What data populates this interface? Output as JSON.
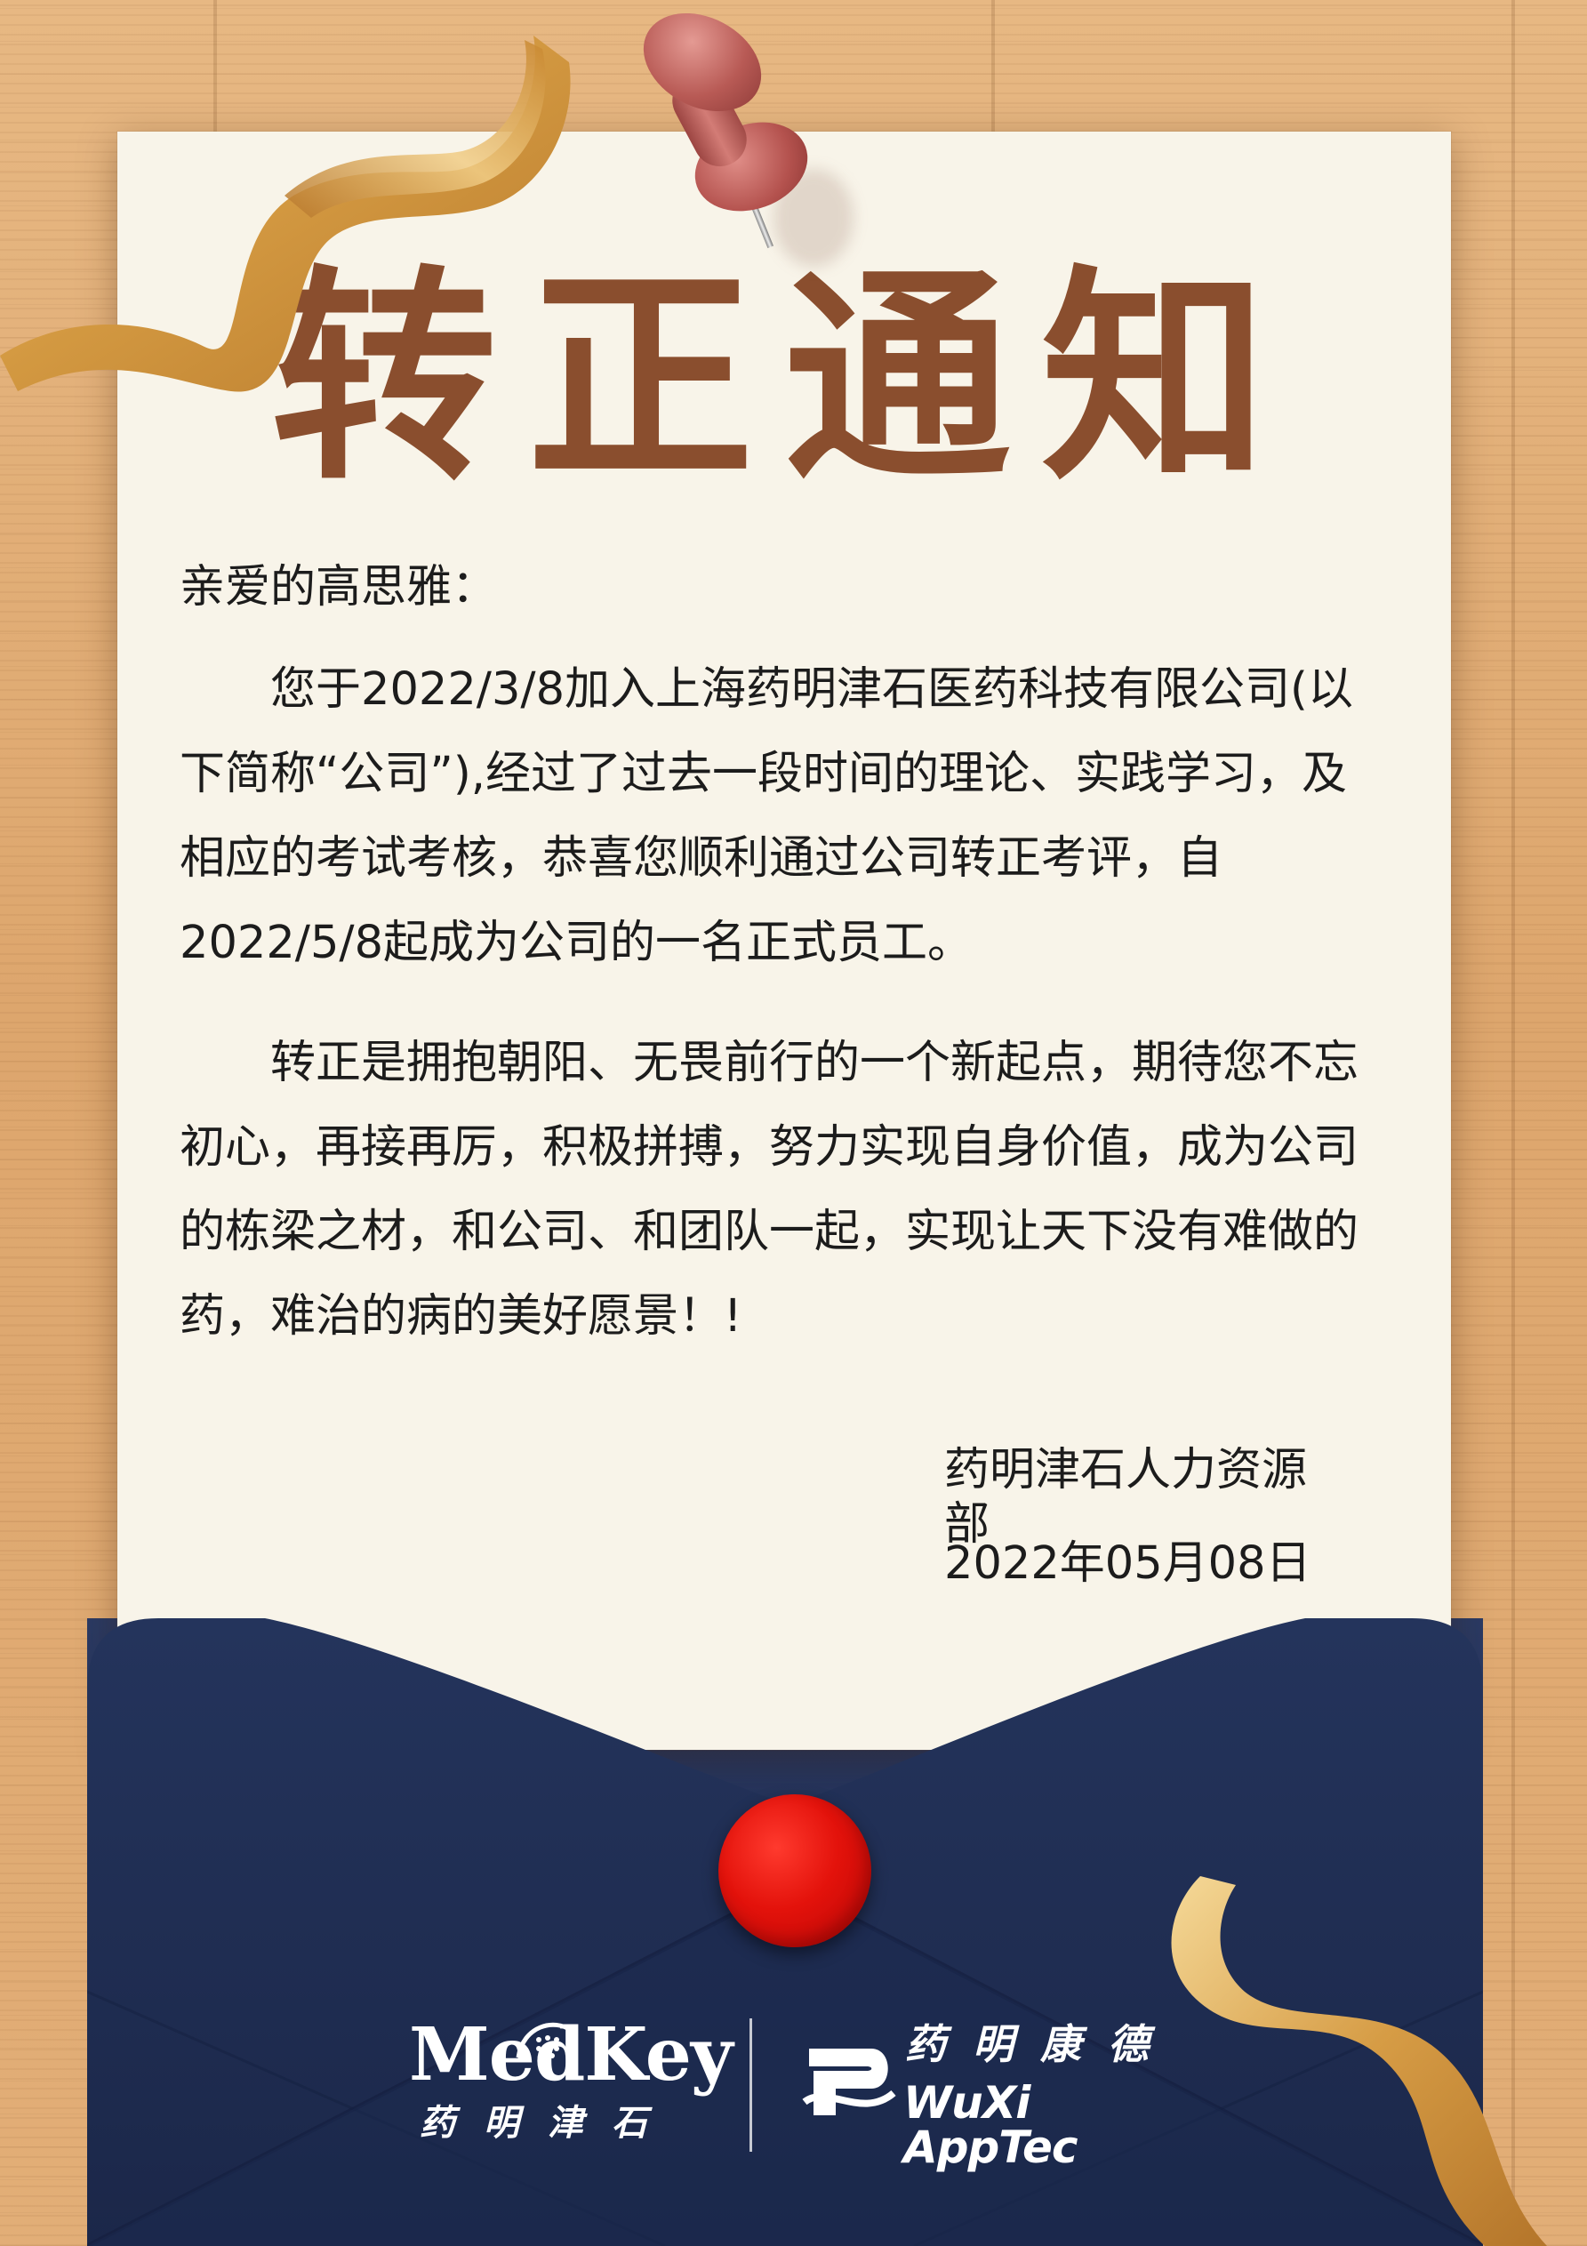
{
  "title": "转正通知",
  "greeting": "亲爱的高思雅：",
  "paragraphs": [
    "您于2022/3/8加入上海药明津石医药科技有限公司(以下简称“公司”),经过了过去一段时间的理论、实践学习，及相应的考试考核，恭喜您顺利通过公司转正考评，自2022/5/8起成为公司的一名正式员工。",
    "转正是拥抱朝阳、无畏前行的一个新起点，期待您不忘初心，再接再厉，积极拼搏，努力实现自身价值，成为公司的栋梁之材，和公司、和团队一起，实现让天下没有难做的药，难治的病的美好愿景！!"
  ],
  "signature": {
    "department": "药明津石人力资源部",
    "date": "2022年05月08日"
  },
  "logos": {
    "medkey_en": "MedKey",
    "medkey_cn": "药明津石",
    "wuxi_cn": "药明康德",
    "wuxi_en": "WuXi AppTec"
  },
  "colors": {
    "title": "#8a4e2e",
    "paper": "#f8f4e9",
    "envelope": "#1f2e52",
    "seal": "#e3120b",
    "ribbon": "#d9a450"
  },
  "icons": [
    "push-pin-icon",
    "wax-seal-icon",
    "gold-ribbon-icon",
    "medkey-logo-icon",
    "wuxi-apptec-logo-icon"
  ]
}
